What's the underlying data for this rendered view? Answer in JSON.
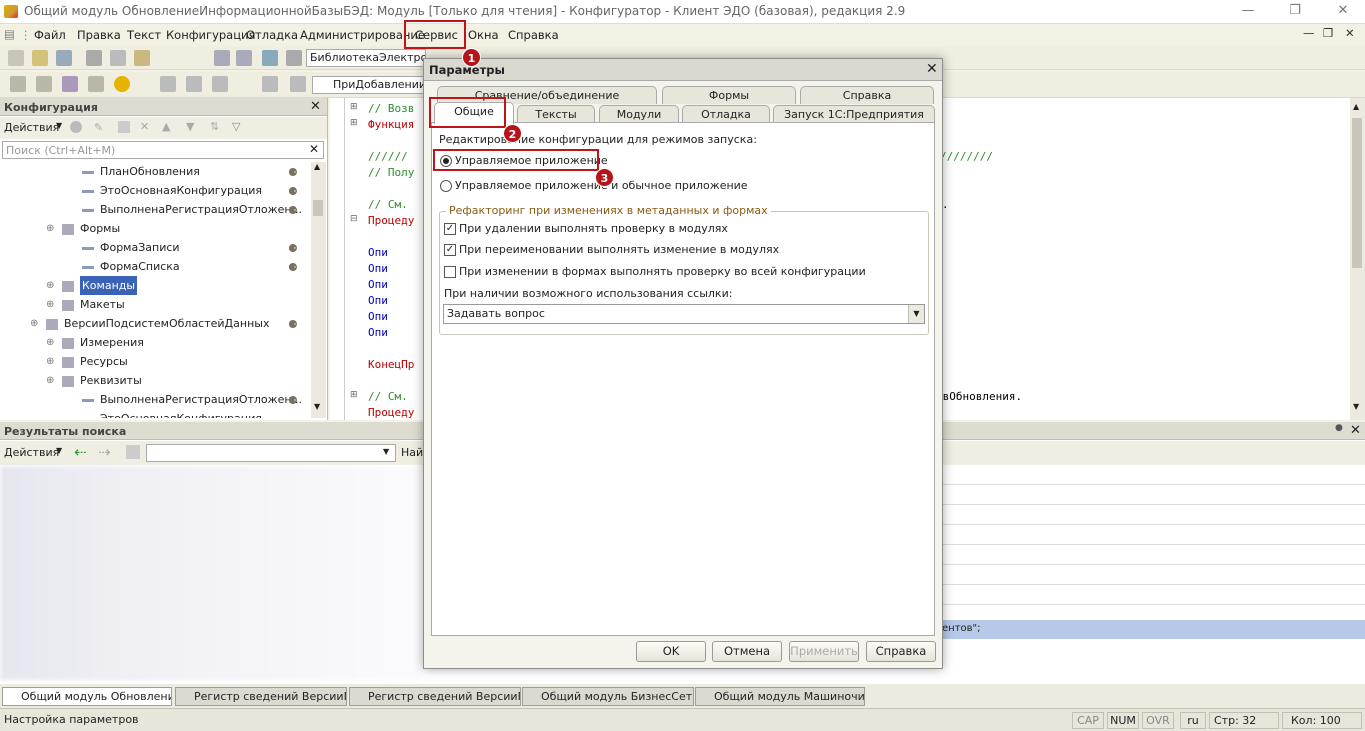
{
  "window": {
    "title": "Общий модуль ОбновлениеИнформационнойБазыБЭД: Модуль [Только для чтения] - Конфигуратор - Клиент ЭДО (базовая), редакция 2.9"
  },
  "menu": [
    "Файл",
    "Правка",
    "Текст",
    "Конфигурация",
    "Отладка",
    "Администрирование",
    "Сервис",
    "Окна",
    "Справка"
  ],
  "toolbar": {
    "combo1": "БиблиотекаЭлектронн",
    "combo2": "ПриДобавленииП"
  },
  "config_panel": {
    "title": "Конфигурация",
    "actions": "Действия",
    "search_placeholder": "Поиск (Ctrl+Alt+M)",
    "tree": [
      {
        "label": "ПланОбновления",
        "indent": 3,
        "lock": true
      },
      {
        "label": "ЭтоОсновнаяКонфигурация",
        "indent": 3,
        "lock": true
      },
      {
        "label": "ВыполненаРегистрацияОтложен...",
        "indent": 3,
        "lock": true
      },
      {
        "label": "Формы",
        "indent": 2,
        "lock": false
      },
      {
        "label": "ФормаЗаписи",
        "indent": 3,
        "lock": true
      },
      {
        "label": "ФормаСписка",
        "indent": 3,
        "lock": true
      },
      {
        "label": "Команды",
        "indent": 2,
        "lock": false
      },
      {
        "label": "Макеты",
        "indent": 2,
        "lock": false
      },
      {
        "label": "ВерсииПодсистемОбластейДанных",
        "indent": 1,
        "lock": true
      },
      {
        "label": "Измерения",
        "indent": 2,
        "lock": false
      },
      {
        "label": "Ресурсы",
        "indent": 2,
        "lock": false
      },
      {
        "label": "Реквизиты",
        "indent": 2,
        "lock": false
      },
      {
        "label": "ВыполненаРегистрацияОтложен...",
        "indent": 3,
        "lock": true
      },
      {
        "label": "ЭтоОсновнаяКонфигурация",
        "indent": 3,
        "lock": false
      }
    ]
  },
  "code": {
    "lines": [
      {
        "text": "// Возв",
        "color": "#2e8b2e"
      },
      {
        "text": "Функция",
        "color": "#c00000"
      },
      {
        "text": "",
        "color": "#000"
      },
      {
        "text": "//////",
        "color": "#2e8b2e"
      },
      {
        "text": "// Полу",
        "color": "#2e8b2e"
      },
      {
        "text": "",
        "color": "#000"
      },
      {
        "text": "// См.",
        "color": "#2e8b2e"
      },
      {
        "text": "Процеду",
        "color": "#c00000"
      },
      {
        "text": "",
        "color": "#000"
      },
      {
        "text": "    Опи",
        "color": "#0000c0"
      },
      {
        "text": "    Опи",
        "color": "#0000c0"
      },
      {
        "text": "    Опи",
        "color": "#0000c0"
      },
      {
        "text": "    Опи",
        "color": "#0000c0"
      },
      {
        "text": "    Опи",
        "color": "#0000c0"
      },
      {
        "text": "    Опи",
        "color": "#0000c0"
      }
    ],
    "line_end": "КонецПр",
    "line_cm2": "// См.",
    "line_proc2": "Процеду",
    "right_slashes": "////////",
    "right_obnov": "овОбновления.",
    "right_entov": "ентов\";"
  },
  "search_results": {
    "title": "Результаты поиска",
    "actions": "Действия",
    "find_label": "Най"
  },
  "dialog": {
    "title": "Параметры",
    "tabs_row1": [
      "Сравнение/объединение",
      "Формы",
      "Справка"
    ],
    "tabs_row2": [
      "Общие",
      "Тексты",
      "Модули",
      "Отладка",
      "Запуск 1С:Предприятия"
    ],
    "edit_label": "Редактирование конфигурации для режимов запуска:",
    "radio1": "Управляемое приложение",
    "radio2": "Управляемое приложение и обычное приложение",
    "group_title": "Рефакторинг при изменениях в метаданных и формах",
    "check1": "При удалении выполнять проверку в модулях",
    "check2": "При переименовании выполнять изменение в модулях",
    "check3": "При изменении в формах выполнять проверку во всей конфигурации",
    "ref_label": "При наличии возможного использования ссылки:",
    "ref_value": "Задавать вопрос",
    "buttons": {
      "ok": "OK",
      "cancel": "Отмена",
      "apply": "Применить",
      "help": "Справка"
    }
  },
  "callouts": [
    "1",
    "2",
    "3"
  ],
  "taskbar": [
    "Общий модуль Обновление...",
    "Регистр сведений ВерсииП...",
    "Регистр сведений ВерсииП...",
    "Общий модуль БизнесСеть:...",
    "Общий модуль Машиночита..."
  ],
  "status": {
    "text": "Настройка параметров",
    "cap": "CAP",
    "num": "NUM",
    "ovr": "OVR",
    "lang": "ru",
    "line": "Стр: 32",
    "col": "Кол: 100"
  }
}
